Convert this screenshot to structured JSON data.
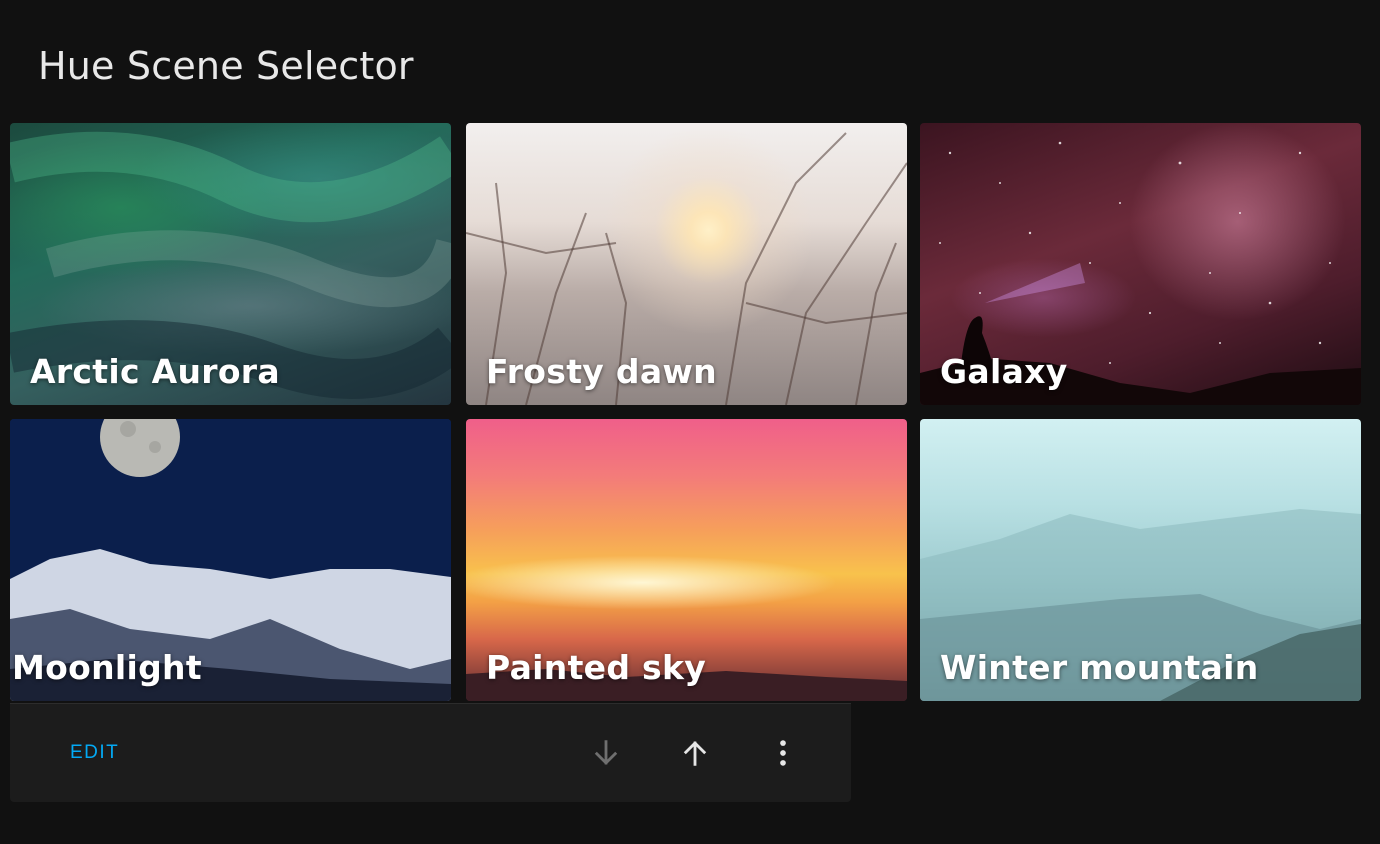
{
  "header": {
    "title": "Hue Scene Selector"
  },
  "scenes": [
    {
      "label": "Arctic Aurora"
    },
    {
      "label": "Frosty dawn"
    },
    {
      "label": "Galaxy"
    },
    {
      "label": "Moonlight"
    },
    {
      "label": "Painted sky"
    },
    {
      "label": "Winter mountain"
    }
  ],
  "toolbar": {
    "edit_label": "EDIT",
    "icons": [
      "arrow-down-icon",
      "arrow-up-icon",
      "more-vert-icon"
    ]
  },
  "colors": {
    "accent": "#03a9f4",
    "background": "#111111",
    "card": "#1c1c1c"
  }
}
